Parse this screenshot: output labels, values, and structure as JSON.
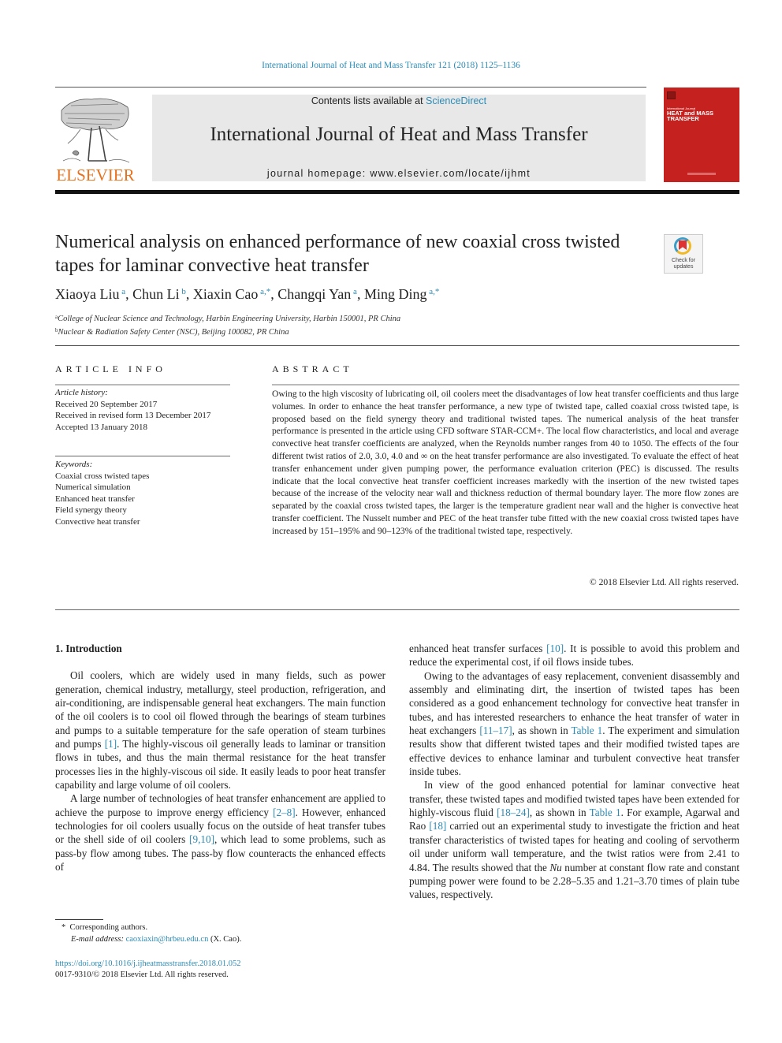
{
  "header": {
    "citation": "International Journal of Heat and Mass Transfer 121 (2018) 1125–1136",
    "contents_prefix": "Contents lists available at ",
    "contents_link": "ScienceDirect",
    "journal_title": "International Journal of Heat and Mass Transfer",
    "homepage": "journal homepage: www.elsevier.com/locate/ijhmt",
    "publisher_logo": "ELSEVIER",
    "cover": {
      "small_text": "International Journal",
      "title_line1": "HEAT and MASS",
      "title_line2": "TRANSFER",
      "color": "#c5221f"
    },
    "link_color": "#2a8bb6"
  },
  "article": {
    "title": "Numerical analysis on enhanced performance of new coaxial cross twisted tapes for laminar convective heat transfer",
    "check_updates_line1": "Check for",
    "check_updates_line2": "updates",
    "authors": [
      {
        "name": "Xiaoya Liu",
        "sup": "a",
        "sep": ", "
      },
      {
        "name": "Chun Li",
        "sup": "b",
        "sep": ", "
      },
      {
        "name": "Xiaxin Cao",
        "sup": "a,*",
        "sep": ", "
      },
      {
        "name": "Changqi Yan",
        "sup": "a",
        "sep": ", "
      },
      {
        "name": "Ming Ding",
        "sup": "a,*",
        "sep": ""
      }
    ],
    "affiliations": [
      {
        "sup": "a",
        "text": "College of Nuclear Science and Technology, Harbin Engineering University, Harbin 150001, PR China"
      },
      {
        "sup": "b",
        "text": "Nuclear & Radiation Safety Center (NSC), Beijing 100082, PR China"
      }
    ]
  },
  "article_info": {
    "label": "ARTICLE INFO",
    "history_head": "Article history:",
    "history": [
      "Received 20 September 2017",
      "Received in revised form 13 December 2017",
      "Accepted 13 January 2018"
    ],
    "keywords_head": "Keywords:",
    "keywords": [
      "Coaxial cross twisted tapes",
      "Numerical simulation",
      "Enhanced heat transfer",
      "Field synergy theory",
      "Convective heat transfer"
    ]
  },
  "abstract": {
    "label": "ABSTRACT",
    "text": "Owing to the high viscosity of lubricating oil, oil coolers meet the disadvantages of low heat transfer coefficients and thus large volumes. In order to enhance the heat transfer performance, a new type of twisted tape, called coaxial cross twisted tape, is proposed based on the field synergy theory and traditional twisted tapes. The numerical analysis of the heat transfer performance is presented in the article using CFD software STAR-CCM+. The local flow characteristics, and local and average convective heat transfer coefficients are analyzed, when the Reynolds number ranges from 40 to 1050. The effects of the four different twist ratios of 2.0, 3.0, 4.0 and ∞ on the heat transfer performance are also investigated. To evaluate the effect of heat transfer enhancement under given pumping power, the performance evaluation criterion (PEC) is discussed. The results indicate that the local convective heat transfer coefficient increases markedly with the insertion of the new twisted tapes because of the increase of the velocity near wall and thickness reduction of thermal boundary layer. The more flow zones are separated by the coaxial cross twisted tapes, the larger is the temperature gradient near wall and the higher is convective heat transfer coefficient. The Nusselt number and PEC of the heat transfer tube fitted with the new coaxial cross twisted tapes have increased by 151–195% and 90–123% of the traditional twisted tape, respectively.",
    "copyright": "© 2018 Elsevier Ltd. All rights reserved."
  },
  "body": {
    "section_heading": "1. Introduction",
    "left": {
      "p1_a": "Oil coolers, which are widely used in many fields, such as power generation, chemical industry, metallurgy, steel production, refrigeration, and air-conditioning, are indispensable general heat exchangers. The main function of the oil coolers is to cool oil flowed through the bearings of steam turbines and pumps to a suitable temperature for the safe operation of steam turbines and pumps ",
      "p1_ref": "[1]",
      "p1_b": ". The highly-viscous oil generally leads to laminar or transition flows in tubes, and thus the main thermal resistance for the heat transfer processes lies in the highly-viscous oil side. It easily leads to poor heat transfer capability and large volume of oil coolers.",
      "p2_a": "A large number of technologies of heat transfer enhancement are applied to achieve the purpose to improve energy efficiency ",
      "p2_ref1": "[2–8]",
      "p2_b": ". However, enhanced technologies for oil coolers usually focus on the outside of heat transfer tubes or the shell side of oil coolers ",
      "p2_ref2": "[9,10]",
      "p2_c": ", which lead to some problems, such as pass-by flow among tubes. The pass-by flow counteracts the enhanced effects of"
    },
    "right": {
      "p1_a": "enhanced heat transfer surfaces ",
      "p1_ref": "[10]",
      "p1_b": ". It is possible to avoid this problem and reduce the experimental cost, if oil flows inside tubes.",
      "p2_a": "Owing to the advantages of easy replacement, convenient disassembly and assembly and eliminating dirt, the insertion of twisted tapes has been considered as a good enhancement technology for convective heat transfer in tubes, and has interested researchers to enhance the heat transfer of water in heat exchangers ",
      "p2_ref1": "[11–17]",
      "p2_b": ", as shown in ",
      "p2_ref2": "Table 1",
      "p2_c": ". The experiment and simulation results show that different twisted tapes and their modified twisted tapes are effective devices to enhance laminar and turbulent convective heat transfer inside tubes.",
      "p3_a": "In view of the good enhanced potential for laminar convective heat transfer, these twisted tapes and modified twisted tapes have been extended for highly-viscous fluid ",
      "p3_ref1": "[18–24]",
      "p3_b": ", as shown in ",
      "p3_ref2": "Table 1",
      "p3_c": ". For example, Agarwal and Rao ",
      "p3_ref3": "[18]",
      "p3_d": " carried out an experimental study to investigate the friction and heat transfer characteristics of twisted tapes for heating and cooling of servotherm oil under uniform wall temperature, and the twist ratios were from 2.41 to 4.84. The results showed that the ",
      "p3_nu": "Nu",
      "p3_e": " number at constant flow rate and constant pumping power were found to be 2.28–5.35 and 1.21–3.70 times of plain tube values, respectively."
    }
  },
  "footnotes": {
    "corresponding_mark": "*",
    "corresponding": "Corresponding authors.",
    "email_label": "E-mail address:",
    "email": "caoxiaxin@hrbeu.edu.cn",
    "email_suffix": " (X. Cao).",
    "doi": "https://doi.org/10.1016/j.ijheatmasstransfer.2018.01.052",
    "issn": "0017-9310/© 2018 Elsevier Ltd. All rights reserved."
  }
}
